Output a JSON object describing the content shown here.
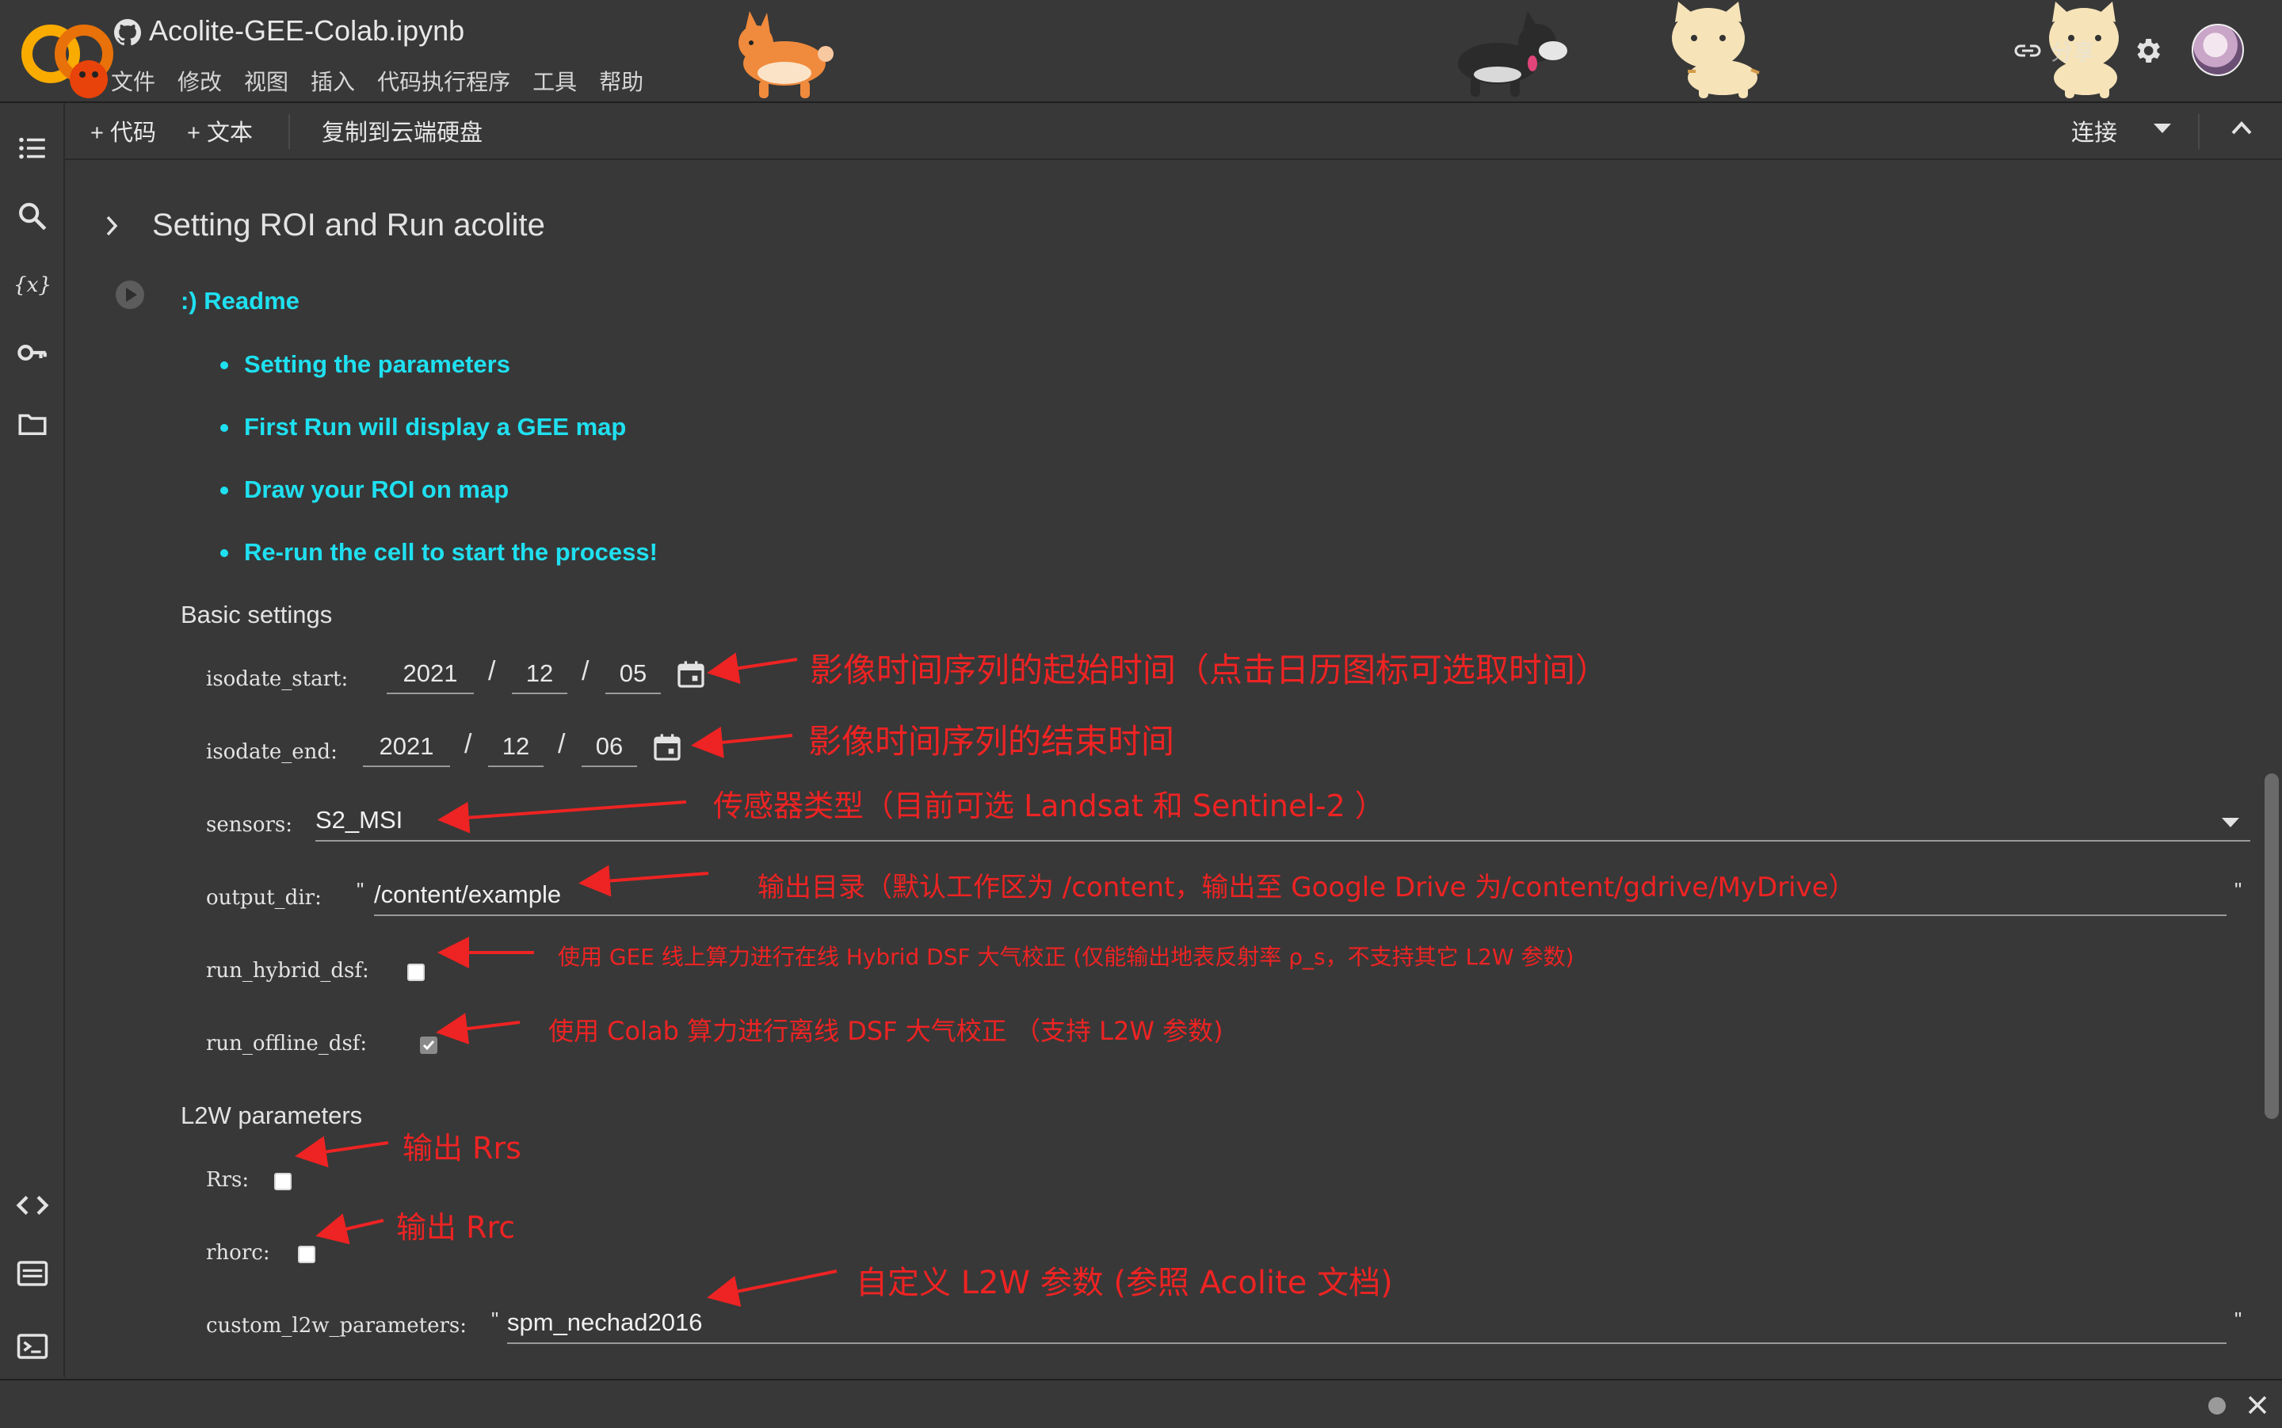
{
  "header": {
    "title": "Acolite-GEE-Colab.ipynb",
    "menu": [
      "文件",
      "修改",
      "视图",
      "插入",
      "代码执行程序",
      "工具",
      "帮助"
    ],
    "share_label": "分享"
  },
  "toolbar": {
    "add_code": "+ 代码",
    "add_text": "+ 文本",
    "copy_to_drive": "复制到云端硬盘",
    "connect": "连接"
  },
  "rail": [
    "table-of-contents-icon",
    "search-icon",
    "variables-icon",
    "key-icon",
    "folder-icon",
    "code-snippets-icon",
    "command-palette-icon",
    "terminal-icon"
  ],
  "section": {
    "title": "Setting ROI and Run acolite"
  },
  "readme": {
    "title": ":) Readme",
    "items": [
      "Setting the parameters",
      "First Run will display a GEE map",
      "Draw your ROI on map",
      "Re-run the cell to start the process!"
    ]
  },
  "basic": {
    "heading": "Basic settings",
    "isodate_start": {
      "label": "isodate_start:",
      "year": "2021",
      "month": "12",
      "day": "05"
    },
    "isodate_end": {
      "label": "isodate_end:",
      "year": "2021",
      "month": "12",
      "day": "06"
    },
    "sensors": {
      "label": "sensors:",
      "value": "S2_MSI"
    },
    "output_dir": {
      "label": "output_dir:",
      "value": "/content/example"
    },
    "run_hybrid_dsf": {
      "label": "run_hybrid_dsf:",
      "checked": false
    },
    "run_offline_dsf": {
      "label": "run_offline_dsf:",
      "checked": true
    }
  },
  "l2w": {
    "heading": "L2W parameters",
    "rrs": {
      "label": "Rrs:",
      "checked": false
    },
    "rhorc": {
      "label": "rhorc:",
      "checked": false
    },
    "custom": {
      "label": "custom_l2w_parameters:",
      "value": "spm_nechad2016"
    }
  },
  "annotations": {
    "start": "影像时间序列的起始时间（点击日历图标可选取时间）",
    "end": "影像时间序列的结束时间",
    "sensors": "传感器类型（目前可选 Landsat 和 Sentinel-2 ）",
    "output_dir": "输出目录（默认工作区为 /content，输出至 Google Drive 为/content/gdrive/MyDrive）",
    "hybrid": "使用 GEE 线上算力进行在线 Hybrid DSF 大气校正 (仅能输出地表反射率 ρ_s，不支持其它 L2W 参数)",
    "offline": "使用 Colab 算力进行离线 DSF 大气校正 （支持 L2W 参数)",
    "rrs": "输出 Rrs",
    "rrc": "输出 Rrc",
    "custom": "自定义 L2W 参数 (参照 Acolite 文档)"
  },
  "colors": {
    "accent_text": "#1fe0f0",
    "annotation": "#ee2323",
    "background": "#383838"
  }
}
